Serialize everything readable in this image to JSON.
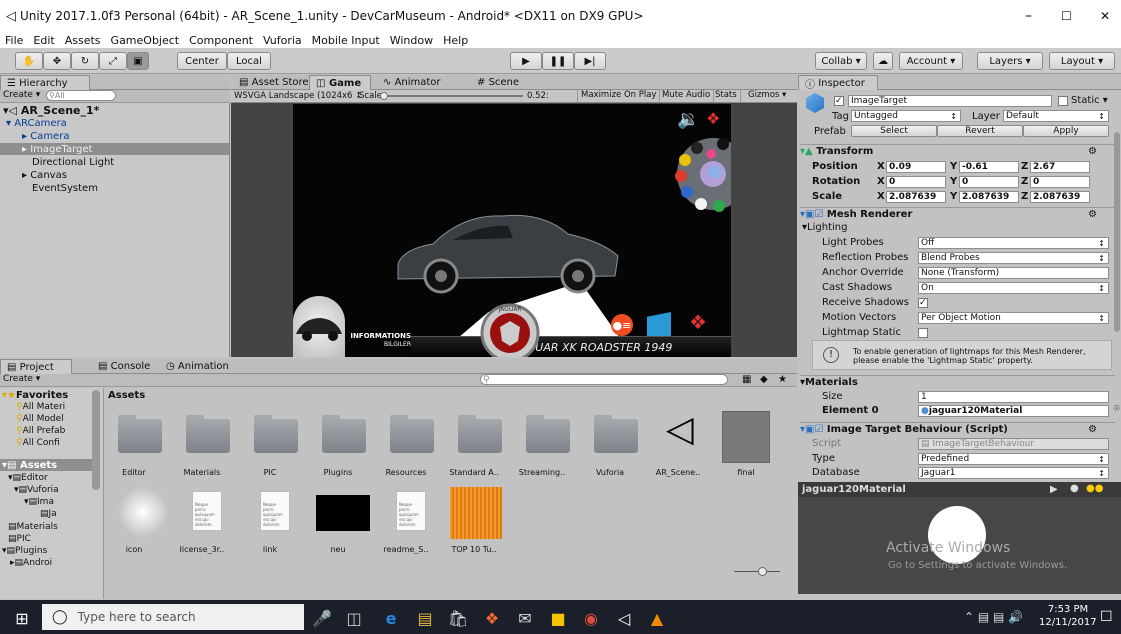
{
  "window": {
    "title": "Unity 2017.1.0f3 Personal (64bit) - AR_Scene_1.unity - DevCarMuseum - Android* <DX11 on DX9 GPU>",
    "minimize": "–",
    "maximize": "☐",
    "close": "✕"
  },
  "menu": [
    "File",
    "Edit",
    "Assets",
    "GameObject",
    "Component",
    "Vuforia",
    "Mobile Input",
    "Window",
    "Help"
  ],
  "toolbar": {
    "pivot": "Center",
    "space": "Local",
    "collab": "Collab",
    "account": "Account",
    "layers": "Layers",
    "layout": "Layout"
  },
  "hierarchy": {
    "tab": "Hierarchy",
    "create": "Create",
    "search_placeholder": "All",
    "scene": "AR_Scene_1*",
    "items": [
      "ARCamera",
      "Camera",
      "ImageTarget",
      "Directional Light",
      "Canvas",
      "EventSystem"
    ]
  },
  "center_tabs": [
    "Asset Store",
    "Game",
    "Animator",
    "Scene"
  ],
  "game_bar": {
    "resolution": "WSVGA Landscape (1024x6",
    "scale_label": "Scale",
    "scale_value": "0.52:",
    "maximize": "Maximize On Play",
    "mute": "Mute Audio",
    "stats": "Stats",
    "gizmos": "Gizmos"
  },
  "game_view": {
    "info_button": "INFORMATIONS",
    "info_sub": "BILGILER",
    "car_title": "JAGUAR XK ROADSTER 1949",
    "badge_text": "JAGUAR"
  },
  "inspector": {
    "tab": "Inspector",
    "object_name": "ImageTarget",
    "static_label": "Static",
    "tag_label": "Tag",
    "tag_value": "Untagged",
    "layer_label": "Layer",
    "layer_value": "Default",
    "prefab_label": "Prefab",
    "prefab_select": "Select",
    "prefab_revert": "Revert",
    "prefab_apply": "Apply",
    "transform": {
      "title": "Transform",
      "position_label": "Position",
      "rotation_label": "Rotation",
      "scale_label": "Scale",
      "position": [
        "0.09",
        "-0.61",
        "2.67"
      ],
      "rotation": [
        "0",
        "0",
        "0"
      ],
      "scale": [
        "2.087639",
        "2.087639",
        "2.087639"
      ]
    },
    "mesh_renderer": {
      "title": "Mesh Renderer",
      "lighting": "Lighting",
      "rows": [
        {
          "label": "Light Probes",
          "value": "Off"
        },
        {
          "label": "Reflection Probes",
          "value": "Blend Probes"
        },
        {
          "label": "Anchor Override",
          "value": "None (Transform)"
        },
        {
          "label": "Cast Shadows",
          "value": "On"
        },
        {
          "label": "Receive Shadows",
          "value": ""
        },
        {
          "label": "Motion Vectors",
          "value": "Per Object Motion"
        },
        {
          "label": "Lightmap Static",
          "value": ""
        }
      ],
      "info": "To enable generation of lightmaps for this Mesh Renderer, please enable the 'Lightmap Static' property."
    },
    "materials": {
      "title": "Materials",
      "size_label": "Size",
      "size": "1",
      "element_label": "Element 0",
      "element": "jaguar120Material"
    },
    "image_target": {
      "title": "Image Target Behaviour (Script)",
      "script_label": "Script",
      "script": "ImageTargetBehaviour",
      "type_label": "Type",
      "type": "Predefined",
      "database_label": "Database",
      "database": "Jaguar1"
    },
    "preview": {
      "title": "jaguar120Material"
    }
  },
  "project": {
    "tabs": [
      "Project",
      "Console",
      "Animation"
    ],
    "create": "Create",
    "favorites": "Favorites",
    "fav_items": [
      "All Materi",
      "All Model",
      "All Prefab",
      "All Confi"
    ],
    "assets_root": "Assets",
    "tree": [
      "Editor",
      "Vuforia",
      "Ima",
      "Ja",
      "Materials",
      "PIC",
      "Plugins",
      "Androi"
    ],
    "breadcrumb": "Assets",
    "row1": [
      "Editor",
      "Materials",
      "PIC",
      "Plugins",
      "Resources",
      "Standard A..",
      "Streaming..",
      "Vuforia",
      "AR_Scene..",
      "final"
    ],
    "row2": [
      "icon",
      "license_3r..",
      "link",
      "neu",
      "readme_S..",
      "TOP 10 Tu.."
    ],
    "doc_text": "Neque porro quisquam est qui dolorem."
  },
  "watermark": {
    "line1": "Activate Windows",
    "line2": "Go to Settings to activate Windows."
  },
  "taskbar": {
    "search": "Type here to search",
    "time": "7:53 PM",
    "date": "12/11/2017"
  }
}
